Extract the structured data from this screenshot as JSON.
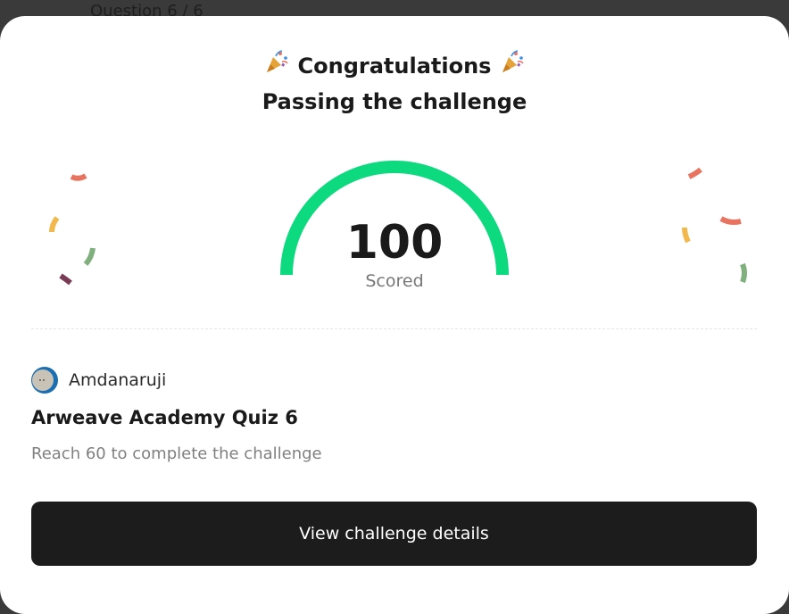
{
  "backdrop": {
    "question_counter": "Question 6 / 6"
  },
  "modal": {
    "congrats": "Congratulations",
    "subtitle": "Passing the challenge",
    "score": {
      "value": "100",
      "label": "Scored",
      "fraction": 1.0,
      "color": "#0dd97f"
    },
    "author": {
      "name": "Amdanaruji"
    },
    "quiz_title": "Arweave Academy Quiz 6",
    "requirement": "Reach 60 to complete the challenge",
    "cta_label": "View challenge details"
  },
  "colors": {
    "gauge": "#0dd97f",
    "button": "#1c1c1c",
    "confetti_red": "#e8735f",
    "confetti_yellow": "#f2b84b",
    "confetti_green": "#7fb07e",
    "confetti_purple": "#7a3b55"
  },
  "icons": {
    "party": "party-popper-icon"
  }
}
